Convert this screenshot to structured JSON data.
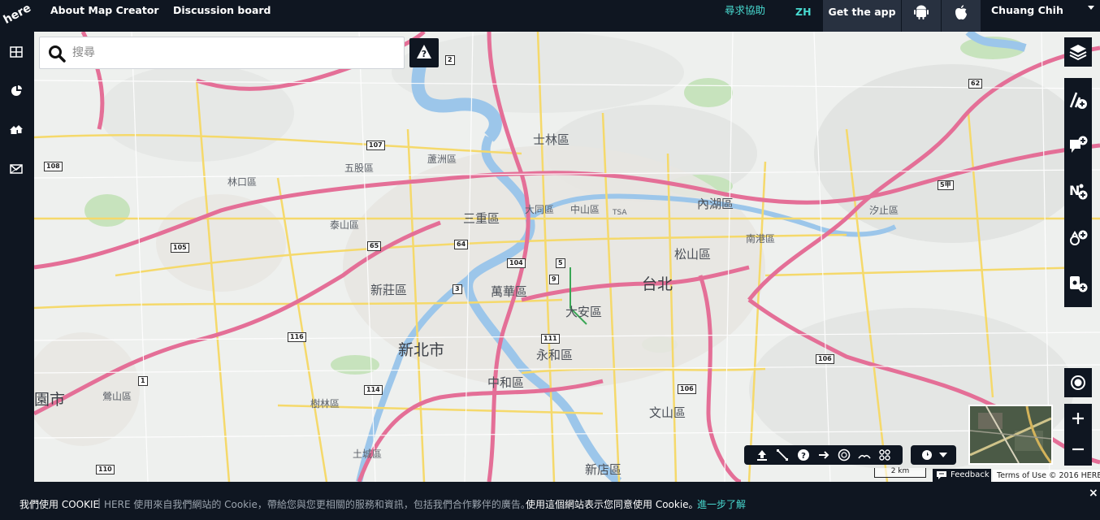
{
  "topbar": {
    "nav_about": "About Map Creator",
    "nav_discussion": "Discussion board",
    "help": "尋求協助",
    "lang": "ZH",
    "get_app": "Get the app",
    "user_name": "Chuang Chih"
  },
  "sidebar": {
    "items": [
      "grid-icon",
      "pie-chart-icon",
      "places-icon",
      "envelope-icon"
    ]
  },
  "search": {
    "placeholder": "搜尋"
  },
  "map": {
    "places": {
      "taipei": "台北",
      "new_taipei": "新北市",
      "sanchong": "三重區",
      "banqiao_area": "新莊區",
      "wanhua": "萬華區",
      "daan": "大安區",
      "zhonghe": "中和區",
      "yonghe": "永和區",
      "songshan": "松山區",
      "neihu": "內湖區",
      "nangang": "南港區",
      "wenshan": "文山區",
      "xindian": "新店區",
      "shilin": "士林區",
      "luzhou": "蘆洲區",
      "datong": "大同區",
      "zhongshan": "中山區",
      "taishan": "泰山區",
      "wugu": "五股區",
      "linkou": "林口區",
      "shulin": "樹林區",
      "tucheng": "土城區",
      "xizhi": "汐止區",
      "yingge": "鶯山區",
      "taoyuan": "園市",
      "tsa": "TSA"
    },
    "shields": [
      "107",
      "108",
      "105",
      "116",
      "114",
      "110",
      "104",
      "111",
      "106",
      "106",
      "5",
      "9",
      "64",
      "65",
      "62",
      "2",
      "3",
      "1",
      "5甲"
    ],
    "scale": "2 km",
    "feedback": "Feedback",
    "terms": "Terms of Use  © 2016 HERE"
  },
  "cookie": {
    "part1": "我們使用 COOKIE",
    "part2": "HERE 使用來自我們網站的 Cookie，帶給您與您更相關的服務和資訊，包括我們合作夥伴的廣告。",
    "part3": "使用這個網站表示您同意使用 Cookie。",
    "link": "進一步了解",
    "close": "×"
  },
  "colors": {
    "chrome": "#0f1621",
    "teal": "#48dad0",
    "motorway": "#e46f97",
    "major_road": "#f5d96b",
    "water": "#9cc6ea",
    "park": "#c7e3bd"
  }
}
